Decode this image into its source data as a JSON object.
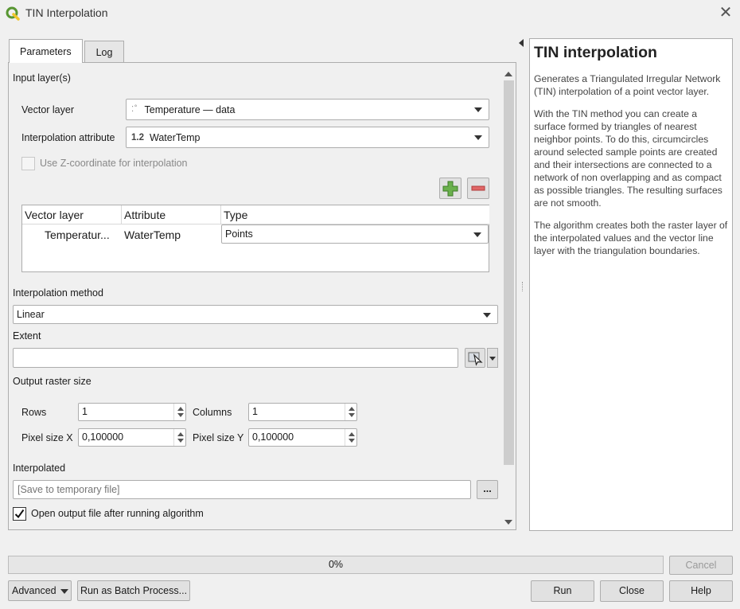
{
  "window": {
    "title": "TIN Interpolation"
  },
  "tabs": [
    {
      "label": "Parameters"
    },
    {
      "label": "Log"
    }
  ],
  "params": {
    "input_layers_label": "Input layer(s)",
    "vector_layer_label": "Vector layer",
    "vector_layer_value": "Temperature — data",
    "interp_attr_label": "Interpolation attribute",
    "interp_attr_type": "1.2",
    "interp_attr_value": "WaterTemp",
    "use_z_label": "Use Z-coordinate for interpolation",
    "use_z_checked": false,
    "table": {
      "headers": [
        "Vector layer",
        "Attribute",
        "Type"
      ],
      "rows": [
        {
          "layer": "Temperatur...",
          "attribute": "WaterTemp",
          "type": "Points"
        }
      ]
    },
    "method_label": "Interpolation method",
    "method_value": "Linear",
    "extent_label": "Extent",
    "extent_value": "",
    "output_size_label": "Output raster size",
    "rows_label": "Rows",
    "rows_value": "1",
    "columns_label": "Columns",
    "columns_value": "1",
    "pixel_x_label": "Pixel size X",
    "pixel_x_value": "0,100000",
    "pixel_y_label": "Pixel size Y",
    "pixel_y_value": "0,100000",
    "interpolated_label": "Interpolated",
    "interpolated_placeholder": "[Save to temporary file]",
    "browse_label": "...",
    "open_output_label": "Open output file after running algorithm",
    "open_output_checked": true
  },
  "help": {
    "title": "TIN interpolation",
    "paragraphs": [
      "Generates a Triangulated Irregular Network (TIN) interpolation of a point vector layer.",
      "With the TIN method you can create a surface formed by triangles of nearest neighbor points. To do this, circumcircles around selected sample points are created and their intersections are connected to a network of non overlapping and as compact as possible triangles. The resulting surfaces are not smooth.",
      "The algorithm creates both the raster layer of the interpolated values and the vector line layer with the triangulation boundaries."
    ]
  },
  "progress": {
    "value": 0,
    "label": "0%"
  },
  "buttons": {
    "cancel": "Cancel",
    "advanced": "Advanced",
    "batch": "Run as Batch Process...",
    "run": "Run",
    "close": "Close",
    "help": "Help"
  },
  "colors": {
    "accent_green": "#589632",
    "qgis_yellow": "#f0c52c",
    "remove_red": "#d9534f"
  }
}
